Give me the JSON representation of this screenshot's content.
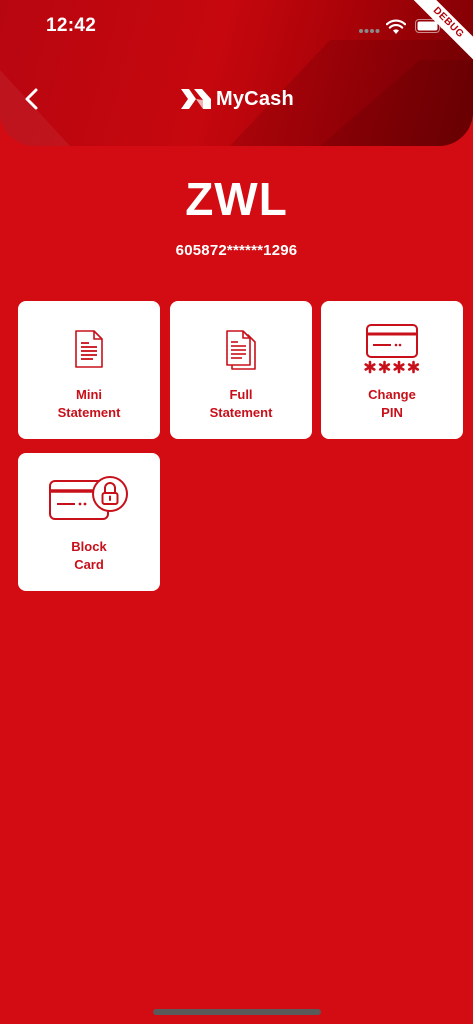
{
  "status_bar": {
    "time": "12:42",
    "debug_label": "DEBUG"
  },
  "header": {
    "brand_name": "MyCash",
    "back_icon": "chevron-left-icon",
    "logo_icon": "mycash-logo-icon"
  },
  "account": {
    "currency": "ZWL",
    "card_number": "605872******1296"
  },
  "actions": [
    {
      "line1": "Mini",
      "line2": "Statement",
      "icon": "document-icon"
    },
    {
      "line1": "Full",
      "line2": "Statement",
      "icon": "documents-stack-icon"
    },
    {
      "line1": "Change",
      "line2": "PIN",
      "icon": "card-pin-icon"
    },
    {
      "line1": "Block",
      "line2": "Card",
      "icon": "card-lock-icon"
    }
  ],
  "colors": {
    "background": "#d20c12",
    "header_dark": "#7c0004",
    "tile_background": "#ffffff",
    "tile_text": "#c8101a"
  }
}
